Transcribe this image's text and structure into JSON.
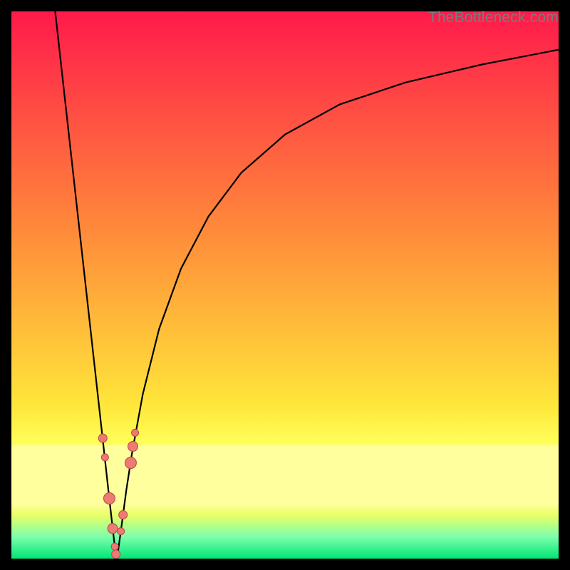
{
  "watermark": "TheBottleneck.com",
  "chart_data": {
    "type": "line",
    "title": "",
    "xlabel": "",
    "ylabel": "",
    "xlim": [
      0,
      100
    ],
    "ylim": [
      0,
      100
    ],
    "grid": false,
    "legend": false,
    "background_gradient": {
      "top_color": "#ff1a4b",
      "mid_color_1": "#ff8a3a",
      "mid_color_2": "#ffe63a",
      "band_color": "#ffff9e",
      "bottom_color": "#00e676"
    },
    "series": [
      {
        "name": "left-branch",
        "type": "line",
        "x": [
          8,
          9,
          10,
          11,
          12,
          13,
          14,
          15,
          16,
          17,
          18,
          18.8,
          19.3
        ],
        "y": [
          100,
          91,
          82,
          73,
          64,
          55,
          46,
          37,
          28,
          19,
          10,
          3,
          0
        ]
      },
      {
        "name": "right-branch",
        "type": "line",
        "x": [
          19.3,
          20,
          21,
          22,
          24,
          27,
          31,
          36,
          42,
          50,
          60,
          72,
          86,
          100
        ],
        "y": [
          0,
          5,
          12.5,
          19,
          30,
          42,
          53,
          62.5,
          70.5,
          77.5,
          83,
          87,
          90.3,
          93
        ]
      }
    ],
    "markers": {
      "name": "cluster-near-minimum",
      "fill": "#ed7a73",
      "stroke": "#b24a44",
      "points": [
        {
          "x": 16.7,
          "y": 22,
          "r": 6
        },
        {
          "x": 17.1,
          "y": 18.5,
          "r": 5
        },
        {
          "x": 17.9,
          "y": 11,
          "r": 8
        },
        {
          "x": 18.5,
          "y": 5.5,
          "r": 7
        },
        {
          "x": 18.9,
          "y": 2.2,
          "r": 5
        },
        {
          "x": 19.1,
          "y": 0.8,
          "r": 6
        },
        {
          "x": 20.0,
          "y": 5,
          "r": 5
        },
        {
          "x": 20.4,
          "y": 8,
          "r": 6
        },
        {
          "x": 21.8,
          "y": 17.5,
          "r": 8
        },
        {
          "x": 22.2,
          "y": 20.5,
          "r": 7
        },
        {
          "x": 22.6,
          "y": 23,
          "r": 5
        }
      ]
    }
  }
}
